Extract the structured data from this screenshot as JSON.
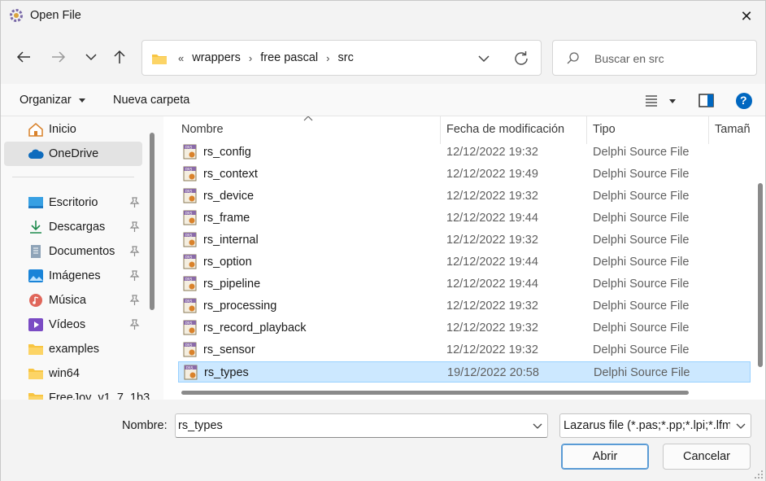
{
  "window": {
    "title": "Open File",
    "close_symbol": "✕"
  },
  "nav": {
    "back_icon": "arrow-left-icon",
    "forward_icon": "arrow-right-icon",
    "recent_icon": "chevron-down-icon",
    "up_icon": "arrow-up-icon"
  },
  "address": {
    "overflow": "«",
    "crumbs": [
      "wrappers",
      "free pascal",
      "src"
    ],
    "separator": "›"
  },
  "search": {
    "placeholder": "Buscar en src"
  },
  "toolbar": {
    "organize_label": "Organizar",
    "new_folder_label": "Nueva carpeta",
    "help_symbol": "?"
  },
  "sidebar": {
    "items": [
      {
        "label": "Inicio",
        "icon": "home-icon"
      },
      {
        "label": "OneDrive",
        "icon": "cloud-icon",
        "selected": true
      },
      {
        "label": "Escritorio",
        "icon": "desktop-icon",
        "pinned": true
      },
      {
        "label": "Descargas",
        "icon": "download-icon",
        "pinned": true
      },
      {
        "label": "Documentos",
        "icon": "document-icon",
        "pinned": true
      },
      {
        "label": "Imágenes",
        "icon": "image-icon",
        "pinned": true
      },
      {
        "label": "Música",
        "icon": "music-icon",
        "pinned": true
      },
      {
        "label": "Vídeos",
        "icon": "video-icon",
        "pinned": true
      },
      {
        "label": "examples",
        "icon": "folder-icon"
      },
      {
        "label": "win64",
        "icon": "folder-icon"
      },
      {
        "label": "FreeJoy_v1_7_1b3",
        "icon": "folder-icon"
      }
    ]
  },
  "columns": {
    "name": "Nombre",
    "modified": "Fecha de modificación",
    "type": "Tipo",
    "size": "Tamañ"
  },
  "files": [
    {
      "name": "rs_config",
      "date": "12/12/2022 19:32",
      "type": "Delphi Source File"
    },
    {
      "name": "rs_context",
      "date": "12/12/2022 19:49",
      "type": "Delphi Source File"
    },
    {
      "name": "rs_device",
      "date": "12/12/2022 19:32",
      "type": "Delphi Source File"
    },
    {
      "name": "rs_frame",
      "date": "12/12/2022 19:44",
      "type": "Delphi Source File"
    },
    {
      "name": "rs_internal",
      "date": "12/12/2022 19:32",
      "type": "Delphi Source File"
    },
    {
      "name": "rs_option",
      "date": "12/12/2022 19:44",
      "type": "Delphi Source File"
    },
    {
      "name": "rs_pipeline",
      "date": "12/12/2022 19:44",
      "type": "Delphi Source File"
    },
    {
      "name": "rs_processing",
      "date": "12/12/2022 19:32",
      "type": "Delphi Source File"
    },
    {
      "name": "rs_record_playback",
      "date": "12/12/2022 19:32",
      "type": "Delphi Source File"
    },
    {
      "name": "rs_sensor",
      "date": "12/12/2022 19:32",
      "type": "Delphi Source File"
    },
    {
      "name": "rs_types",
      "date": "19/12/2022 20:58",
      "type": "Delphi Source File",
      "selected": true
    }
  ],
  "footer": {
    "name_label": "Nombre:",
    "name_value": "rs_types",
    "filter_value": "Lazarus file (*.pas;*.pp;*.lpi;*.lfm",
    "open_label": "Abrir",
    "cancel_label": "Cancelar"
  },
  "colors": {
    "selection": "#cce8ff",
    "selection_border": "#99d1ff",
    "accent": "#0067c0"
  }
}
